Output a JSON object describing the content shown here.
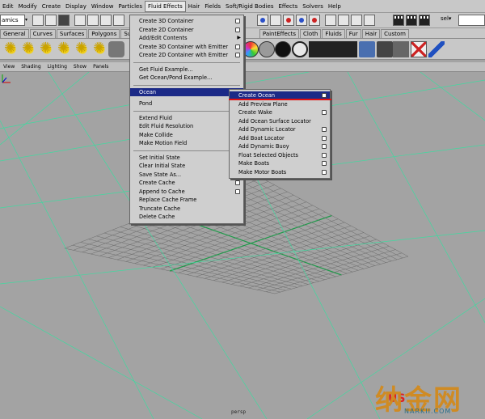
{
  "menubar": {
    "items": [
      "Edit",
      "Modify",
      "Create",
      "Display",
      "Window",
      "Particles",
      "Fluid Effects",
      "Hair",
      "Fields",
      "Soft/Rigid Bodies",
      "Effects",
      "Solvers",
      "Help"
    ],
    "active": "Fluid Effects"
  },
  "statusline": {
    "mode_value": "amics",
    "select_label": "sel▾"
  },
  "shelf": {
    "tabs": [
      "General",
      "Curves",
      "Surfaces",
      "Polygons",
      "Subdivs",
      "",
      "",
      "",
      "",
      "",
      "",
      "",
      "",
      "",
      "PaintEffects",
      "Cloth",
      "Fluids",
      "Fur",
      "Hair",
      "Custom"
    ]
  },
  "panel_menu": [
    "View",
    "Shading",
    "Lighting",
    "Show",
    "Panels"
  ],
  "fluid_menu": {
    "items": [
      {
        "label": "Create 3D Container",
        "box": true
      },
      {
        "label": "Create 2D Container",
        "box": true
      },
      {
        "label": "Add/Edit Contents",
        "submenu": true
      },
      {
        "label": "Create 3D Container with Emitter",
        "box": true
      },
      {
        "label": "Create 2D Container with Emitter",
        "box": true
      },
      {
        "sep": true
      },
      {
        "label": "Get Fluid Example..."
      },
      {
        "label": "Get Ocean/Pond Example..."
      },
      {
        "sep": true
      },
      {
        "label": "Ocean",
        "submenu": true,
        "selected": true
      },
      {
        "gap": true
      },
      {
        "label": "Pond",
        "submenu": true
      },
      {
        "sep": true
      },
      {
        "label": "Extend Fluid"
      },
      {
        "label": "Edit Fluid Resolution"
      },
      {
        "label": "Make Collide"
      },
      {
        "label": "Make Motion Field"
      },
      {
        "sep": true
      },
      {
        "label": "Set Initial State"
      },
      {
        "label": "Clear Initial State"
      },
      {
        "label": "Save State As..."
      },
      {
        "label": "Create Cache",
        "box": true
      },
      {
        "label": "Append to Cache",
        "box": true
      },
      {
        "label": "Replace Cache Frame"
      },
      {
        "label": "Truncate Cache"
      },
      {
        "label": "Delete Cache"
      }
    ]
  },
  "ocean_menu": {
    "items": [
      {
        "label": "Create Ocean",
        "box": true,
        "selected": true
      },
      {
        "label": "Add Preview Plane"
      },
      {
        "label": "Create Wake",
        "box": true
      },
      {
        "label": "Add Ocean Surface Locator"
      },
      {
        "label": "Add Dynamic Locator",
        "box": true
      },
      {
        "label": "Add Boat Locator",
        "box": true
      },
      {
        "label": "Add Dynamic Buoy",
        "box": true
      },
      {
        "label": "Float Selected Objects",
        "box": true
      },
      {
        "label": "Make Boats",
        "box": true
      },
      {
        "label": "Make Motor Boats",
        "box": true
      }
    ]
  },
  "viewport": {
    "camera_label": "persp",
    "watermark_text": "纳金网",
    "watermark_sub": "NARKII.COM",
    "watermark_logo": "US"
  },
  "colors": {
    "grid_major": "#41d9a0",
    "grid_minor": "#6b6b6b",
    "grid_axis": "#1f9a4a",
    "menu_highlight": "#1c2a87",
    "viewport_bg": "#a3a3a3"
  }
}
